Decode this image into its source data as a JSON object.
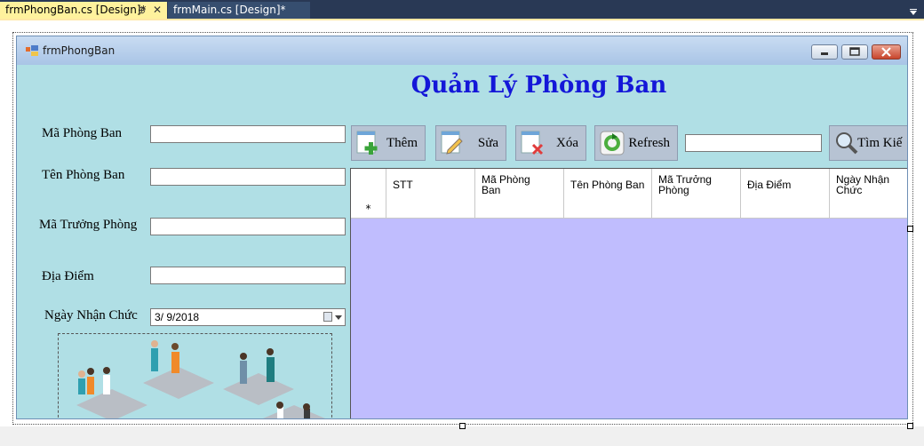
{
  "ide": {
    "tabs": [
      {
        "label": "frmPhongBan.cs [Design]*",
        "active": true
      },
      {
        "label": "frmMain.cs [Design]*",
        "active": false
      }
    ],
    "pin_glyph": "⊕",
    "close_glyph": "✕"
  },
  "window": {
    "title": "frmPhongBan"
  },
  "heading": "Quản Lý Phòng Ban",
  "fields": {
    "ma_phong_ban": {
      "label": "Mã Phòng Ban",
      "value": ""
    },
    "ten_phong_ban": {
      "label": "Tên Phòng Ban",
      "value": ""
    },
    "ma_truong_phong": {
      "label": "Mã Trưởng Phòng",
      "value": ""
    },
    "dia_diem": {
      "label": "Địa Điểm",
      "value": ""
    },
    "ngay_nhan_chuc": {
      "label": "Ngày Nhận Chức",
      "value": "3/  9/2018"
    }
  },
  "toolbar": {
    "them": "Thêm",
    "sua": "Sửa",
    "xoa": "Xóa",
    "refresh": "Refresh",
    "tim_kiem": "Tìm Kiế",
    "search_value": ""
  },
  "grid": {
    "columns": [
      "STT",
      "Mã Phòng\nBan",
      "Tên Phòng Ban",
      "Mã Trưởng Phòng",
      "Địa Điểm",
      "Ngày Nhận\nChức"
    ],
    "new_row_marker": "*"
  },
  "icons": {
    "add": "plus-icon",
    "edit": "pencil-icon",
    "delete": "delete-icon",
    "refresh": "refresh-icon",
    "search": "magnifier-icon"
  },
  "colors": {
    "form_bg": "#b0dfe5",
    "heading": "#1417d8",
    "grid_bg": "#c0bdfe",
    "tab_active": "#fff29d"
  }
}
